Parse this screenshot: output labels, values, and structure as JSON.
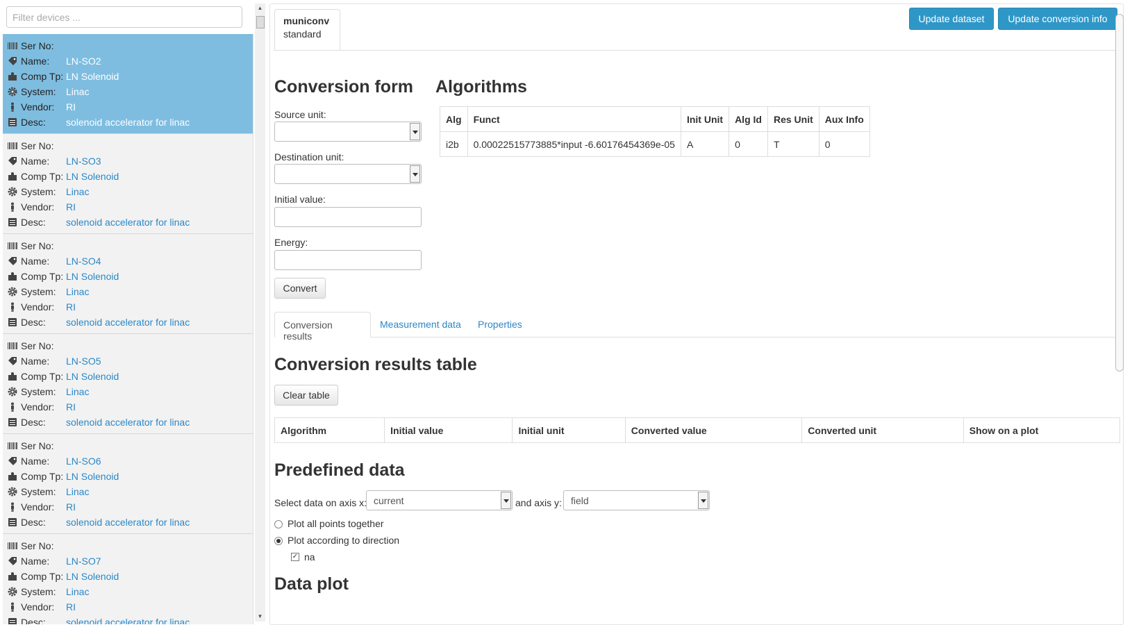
{
  "filter": {
    "placeholder": "Filter devices ..."
  },
  "labels": {
    "ser_no": "Ser No:",
    "name": "Name:",
    "comp_tp": "Comp Tp:",
    "system": "System:",
    "vendor": "Vendor:",
    "desc": "Desc:"
  },
  "devices": [
    {
      "ser_no": "",
      "name": "LN-SO2",
      "comp_tp": "LN Solenoid",
      "system": "Linac",
      "vendor": "RI",
      "desc": "solenoid accelerator for linac",
      "selected": true
    },
    {
      "ser_no": "",
      "name": "LN-SO3",
      "comp_tp": "LN Solenoid",
      "system": "Linac",
      "vendor": "RI",
      "desc": "solenoid accelerator for linac"
    },
    {
      "ser_no": "",
      "name": "LN-SO4",
      "comp_tp": "LN Solenoid",
      "system": "Linac",
      "vendor": "RI",
      "desc": "solenoid accelerator for linac"
    },
    {
      "ser_no": "",
      "name": "LN-SO5",
      "comp_tp": "LN Solenoid",
      "system": "Linac",
      "vendor": "RI",
      "desc": "solenoid accelerator for linac"
    },
    {
      "ser_no": "",
      "name": "LN-SO6",
      "comp_tp": "LN Solenoid",
      "system": "Linac",
      "vendor": "RI",
      "desc": "solenoid accelerator for linac"
    },
    {
      "ser_no": "",
      "name": "LN-SO7",
      "comp_tp": "LN Solenoid",
      "system": "Linac",
      "vendor": "RI",
      "desc": "solenoid accelerator for linac"
    }
  ],
  "dataset_tab": {
    "name": "municonv",
    "type": "standard"
  },
  "toolbar": {
    "update_dataset": "Update dataset",
    "update_conversion": "Update conversion info"
  },
  "conversion_form": {
    "title": "Conversion form",
    "source_unit_label": "Source unit:",
    "source_unit_value": "",
    "dest_unit_label": "Destination unit:",
    "dest_unit_value": "",
    "initial_value_label": "Initial value:",
    "initial_value": "",
    "energy_label": "Energy:",
    "energy": "",
    "convert_label": "Convert"
  },
  "algorithms": {
    "title": "Algorithms",
    "headers": [
      "Alg",
      "Funct",
      "Init Unit",
      "Alg Id",
      "Res Unit",
      "Aux Info"
    ],
    "rows": [
      [
        "i2b",
        "0.00022515773885*input -6.60176454369e-05",
        "A",
        "0",
        "T",
        "0"
      ]
    ]
  },
  "result_tabs": [
    "Conversion results",
    "Measurement data",
    "Properties"
  ],
  "results": {
    "title": "Conversion results table",
    "clear_label": "Clear table",
    "headers": [
      "Algorithm",
      "Initial value",
      "Initial unit",
      "Converted value",
      "Converted unit",
      "Show on a plot"
    ]
  },
  "predefined": {
    "title": "Predefined data",
    "axis_x_label": "Select data on axis x:",
    "axis_x_value": "current",
    "axis_y_label": "and axis y:",
    "axis_y_value": "field",
    "plot_all": "Plot all points together",
    "plot_direction": "Plot according to direction",
    "direction_option": "na"
  },
  "data_plot": {
    "title": "Data plot"
  },
  "colors": {
    "accent": "#2f97c8",
    "selected_row": "#7ebde0",
    "link": "#2b87c7"
  }
}
